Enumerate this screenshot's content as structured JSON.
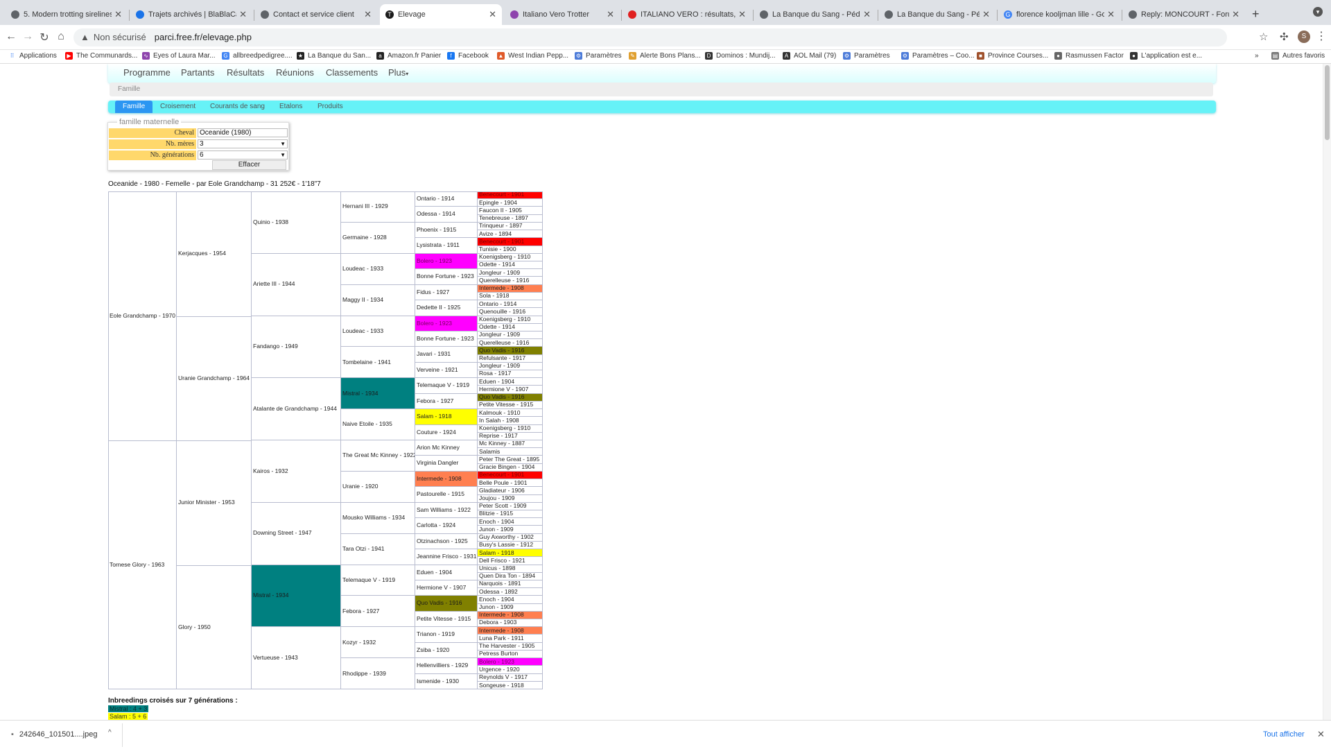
{
  "browser": {
    "tabs": [
      {
        "label": "5. Modern trotting sirelines",
        "active": false
      },
      {
        "label": "Trajets archivés | BlaBlaCar",
        "active": false
      },
      {
        "label": "Contact et service client",
        "active": false
      },
      {
        "label": "Elevage",
        "active": true
      },
      {
        "label": "Italiano Vero Trotter",
        "active": false
      },
      {
        "label": "ITALIANO VERO : résultats, pa",
        "active": false
      },
      {
        "label": "La Banque du Sang - Pédigree",
        "active": false
      },
      {
        "label": "La Banque du Sang - Pédigree",
        "active": false
      },
      {
        "label": "florence kooljman lille - Googl",
        "active": false
      },
      {
        "label": "Reply: MONCOURT - Forum",
        "active": false
      }
    ],
    "security_label": "Non sécurisé",
    "url": "parci.free.fr/elevage.php",
    "avatar_letter": "S",
    "bookmarks": [
      "Applications",
      "The Communards...",
      "Eyes of Laura Mar...",
      "allbreedpedigree....",
      "La Banque du San...",
      "Amazon.fr Panier",
      "Facebook",
      "West Indian Pepp...",
      "Paramètres",
      "Alerte Bons Plans...",
      "Dominos : Mundij...",
      "AOL Mail (79)",
      "Paramètres",
      "Paramètres – Coo...",
      "Province Courses...",
      "Rasmussen Factor",
      "L'application est e..."
    ],
    "bookmarks_more": "»",
    "other_bookmarks": "Autres favoris"
  },
  "site": {
    "main_nav": [
      "Programme",
      "Partants",
      "Résultats",
      "Réunions",
      "Classements",
      "Plus"
    ],
    "search_placeholder": "Famille",
    "sub_nav": {
      "active": "Famille",
      "items": [
        "Croisement",
        "Courants de sang",
        "Etalons",
        "Produits"
      ]
    },
    "form": {
      "legend": "famille maternelle",
      "fields": [
        {
          "label": "Cheval",
          "value": "Oceanide (1980)"
        },
        {
          "label": "Nb. mères",
          "value": "3"
        },
        {
          "label": "Nb. générations",
          "value": "6"
        }
      ],
      "button": "Effacer"
    },
    "horse_info": "Oceanide - 1980 - Femelle - par Eole Grandchamp - 31 252€ - 1'18\"7",
    "pedigree": {
      "g1": [
        "Eole Grandchamp - 1970",
        "Tornese Glory - 1963"
      ],
      "g2": [
        "Kerjacques - 1954",
        "Uranie Grandchamp - 1964",
        "Junior Minister - 1953",
        "Glory - 1950"
      ],
      "g3": [
        "Quinio - 1938",
        "Ariette III - 1944",
        "Fandango - 1949",
        "Atalante de Grandchamp - 1944",
        "Kairos - 1932",
        "Downing Street - 1947",
        "Mistral - 1934",
        "Vertueuse - 1943"
      ],
      "g4": [
        "Hernani III - 1929",
        "Germaine - 1928",
        "Loudeac - 1933",
        "Maggy II - 1934",
        "Loudeac - 1933",
        "Tombelaine - 1941",
        "Mistral - 1934",
        "Naive Etoile - 1935",
        "The Great Mc Kinney - 1922",
        "Uranie - 1920",
        "Mousko Williams - 1934",
        "Tara Otzi - 1941",
        "Telemaque V - 1919",
        "Febora - 1927",
        "Kozyr - 1932",
        "Rhodippe - 1939"
      ],
      "g5": [
        "Ontario - 1914",
        "Odessa - 1914",
        "Phoenix - 1915",
        "Lysistrata - 1911",
        "Bolero - 1923",
        "Bonne Fortune - 1923",
        "Fidus - 1927",
        "Dedette II - 1925",
        "Bolero - 1923",
        "Bonne Fortune - 1923",
        "Javari - 1931",
        "Verveine - 1921",
        "Telemaque V - 1919",
        "Febora - 1927",
        "Salam - 1918",
        "Couture - 1924",
        "Arion Mc Kinney",
        "Virginia Dangler",
        "Intermede - 1908",
        "Pastourelle - 1915",
        "Sam Williams - 1922",
        "Carlotta - 1924",
        "Otzinachson - 1925",
        "Jeannine Frisco - 1931",
        "Eduen - 1904",
        "Hermione V - 1907",
        "Quo Vadis - 1916",
        "Petite Vitesse - 1915",
        "Trianon - 1919",
        "Zsiba - 1920",
        "Hellenvilliers - 1929",
        "Ismenide - 1930"
      ],
      "g6": [
        "Benecourt - 1901",
        "Epingle - 1904",
        "Faucon II - 1905",
        "Tenebreuse - 1897",
        "Trinqueur - 1897",
        "Avize - 1894",
        "Benecourt - 1901",
        "Tunisie - 1900",
        "Koenigsberg - 1910",
        "Odette - 1914",
        "Jongleur - 1909",
        "Querelleuse - 1916",
        "Intermede - 1908",
        "Sola - 1918",
        "Ontario - 1914",
        "Quenouille - 1916",
        "Koenigsberg - 1910",
        "Odette - 1914",
        "Jongleur - 1909",
        "Querelleuse - 1916",
        "Quo Vadis - 1916",
        "Refulsante - 1917",
        "Jongleur - 1909",
        "Rosa - 1917",
        "Eduen - 1904",
        "Hermione V - 1907",
        "Quo Vadis - 1916",
        "Petite Vitesse - 1915",
        "Kalmouk - 1910",
        "In Salah - 1908",
        "Koenigsberg - 1910",
        "Reprise - 1917",
        "Mc Kinney - 1887",
        "Salamis",
        "Peter The Great - 1895",
        "Gracie Bingen - 1904",
        "Benecourt - 1901",
        "Belle Poule - 1901",
        "Gladiateur - 1906",
        "Joujou - 1909",
        "Peter Scott - 1909",
        "Blitzie - 1915",
        "Enoch - 1904",
        "Junon - 1909",
        "Guy Axworthy - 1902",
        "Busy's Lassie - 1912",
        "Salam - 1918",
        "Dell Frisco - 1921",
        "Unicus - 1898",
        "Quen Dira Ton - 1894",
        "Narquois - 1891",
        "Odessa - 1892",
        "Enoch - 1904",
        "Junon - 1909",
        "Intermede - 1908",
        "Debora - 1903",
        "Intermede - 1908",
        "Luna Park - 1911",
        "The Harvester - 1905",
        "Petress Burton",
        "Bolero - 1923",
        "Urgence - 1920",
        "Reynolds V - 1917",
        "Songeuse - 1918"
      ]
    },
    "highlight_colors": {
      "Mistral": "#008080",
      "Salam": "#ffff00",
      "Benecourt": "#ff0000",
      "Bolero": "#ff00ff",
      "Intermede": "#ff7f50",
      "Quo Vadis": "#808000"
    },
    "inbreeding_title": "Inbreedings croisés sur 7 générations :",
    "inbreedings": [
      {
        "text": "Mistral : 4 + 3",
        "color": "#008080"
      },
      {
        "text": "Salam : 5 + 6",
        "color": "#ffff00"
      }
    ]
  },
  "downloads": {
    "file": "242646_101501....jpeg",
    "show_all": "Tout afficher"
  }
}
